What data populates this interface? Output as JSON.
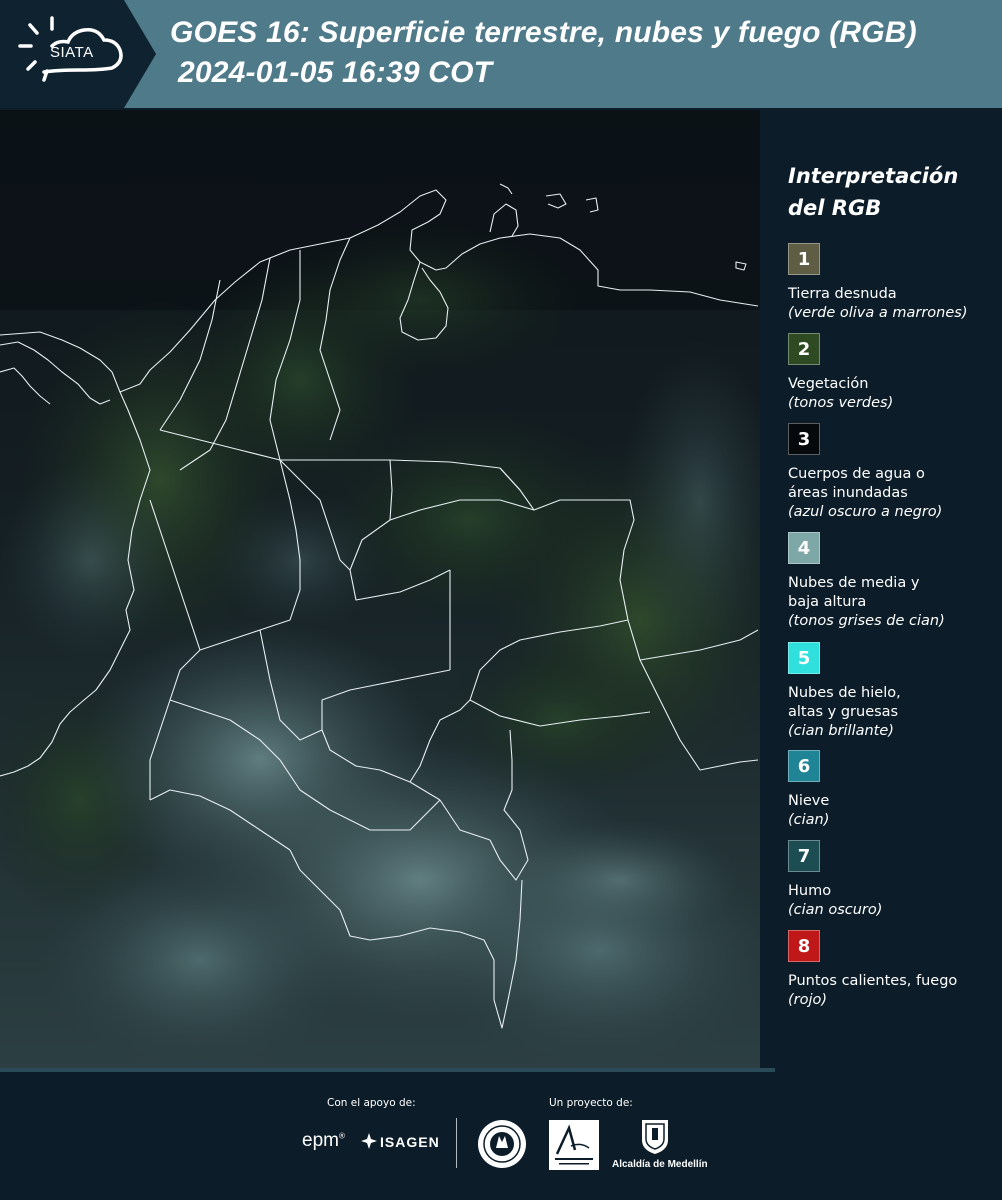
{
  "header": {
    "logo_text": "SIATA",
    "title_line1": "GOES 16: Superficie terrestre, nubes y fuego (RGB)",
    "title_line2": "2024-01-05 16:39 COT"
  },
  "legend": {
    "title_line1": "Interpretación",
    "title_line2": "del RGB",
    "items": [
      {
        "num": "1",
        "color": "#5f5e45",
        "label": "Tierra desnuda",
        "desc": "(verde oliva a marrones)"
      },
      {
        "num": "2",
        "color": "#2e4a22",
        "label": "Vegetación",
        "desc": "(tonos verdes)"
      },
      {
        "num": "3",
        "color": "#05090c",
        "label": "Cuerpos de agua o áreas inundadas",
        "desc": "(azul oscuro a negro)"
      },
      {
        "num": "4",
        "color": "#7ea7a8",
        "label": "Nubes de media y baja altura",
        "desc": "(tonos grises de cian)"
      },
      {
        "num": "5",
        "color": "#2fe0dc",
        "label": "Nubes de hielo, altas y gruesas",
        "desc": "(cian brillante)"
      },
      {
        "num": "6",
        "color": "#1f8496",
        "label": "Nieve",
        "desc": "(cian)"
      },
      {
        "num": "7",
        "color": "#1c4d52",
        "label": "Humo",
        "desc": "(cian oscuro)"
      },
      {
        "num": "8",
        "color": "#c01818",
        "label": "Puntos calientes, fuego",
        "desc": "(rojo)"
      }
    ]
  },
  "footer": {
    "support_caption": "Con el apoyo de:",
    "project_caption": "Un proyecto de:",
    "epm": "epm",
    "isagen": "ISAGEN",
    "alcaldia": "Alcaldía de Medellín"
  },
  "colors": {
    "header_bg": "#4e7a8a",
    "page_bg": "#0c1d29",
    "border_lines": "#e6eef2"
  }
}
